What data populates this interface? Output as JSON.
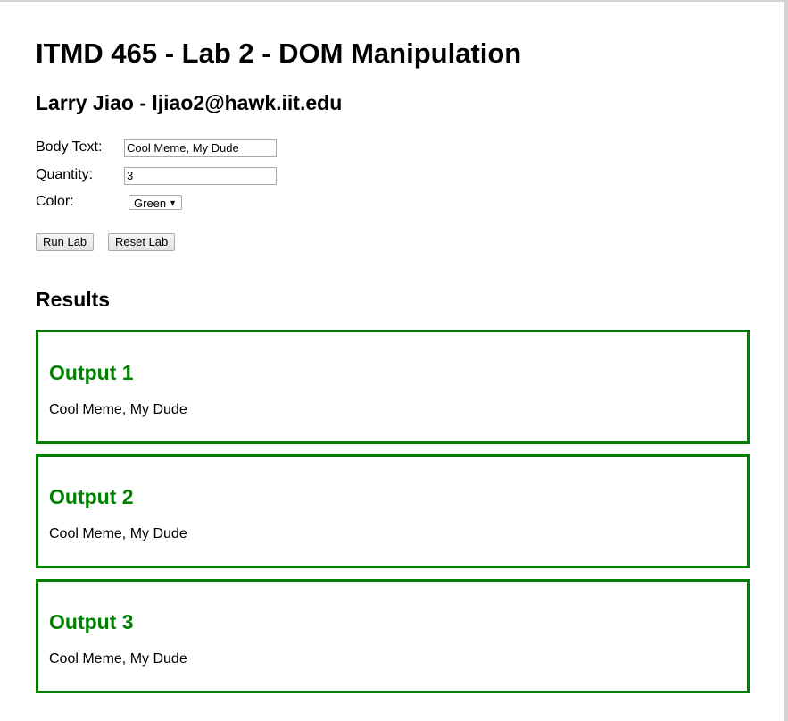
{
  "page": {
    "title": "ITMD 465 - Lab 2 - DOM Manipulation",
    "subtitle": "Larry Jiao - ljiao2@hawk.iit.edu"
  },
  "form": {
    "body_text": {
      "label": "Body Text:",
      "value": "Cool Meme, My Dude"
    },
    "quantity": {
      "label": "Quantity:",
      "value": "3"
    },
    "color": {
      "label": "Color:",
      "selected": "Green"
    },
    "run_label": "Run Lab",
    "reset_label": "Reset Lab"
  },
  "results": {
    "heading": "Results",
    "accent_color": "#008000",
    "outputs": [
      {
        "title": "Output 1",
        "text": "Cool Meme, My Dude"
      },
      {
        "title": "Output 2",
        "text": "Cool Meme, My Dude"
      },
      {
        "title": "Output 3",
        "text": "Cool Meme, My Dude"
      }
    ]
  }
}
